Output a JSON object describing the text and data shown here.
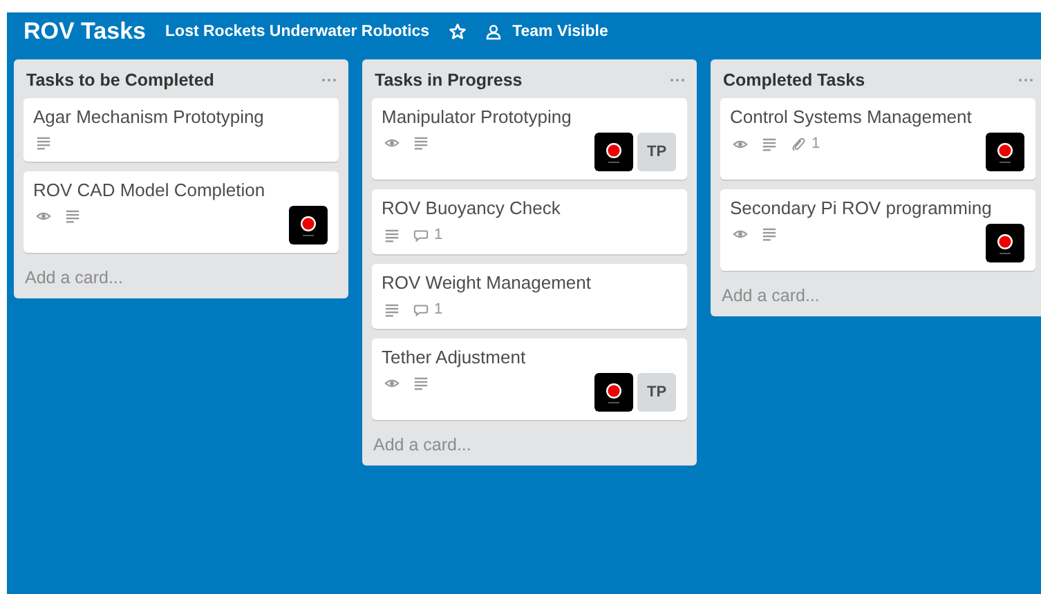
{
  "board": {
    "title": "ROV Tasks",
    "team": "Lost Rockets Underwater Robotics",
    "starred": false,
    "visibility": "Team Visible"
  },
  "lists": [
    {
      "title": "Tasks to be Completed",
      "add_card": "Add a card...",
      "cards": [
        {
          "title": "Agar Mechanism Prototyping",
          "badges": [
            {
              "kind": "description"
            }
          ]
        },
        {
          "title": "ROV CAD Model Completion",
          "badges": [
            {
              "kind": "watch"
            },
            {
              "kind": "description"
            }
          ],
          "members": [
            {
              "kind": "avatar"
            }
          ]
        }
      ]
    },
    {
      "title": "Tasks in Progress",
      "add_card": "Add a card...",
      "cards": [
        {
          "title": "Manipulator Prototyping",
          "badges": [
            {
              "kind": "watch"
            },
            {
              "kind": "description"
            }
          ],
          "members": [
            {
              "kind": "avatar"
            },
            {
              "kind": "initials",
              "initials": "TP"
            }
          ]
        },
        {
          "title": "ROV Buoyancy Check",
          "badges": [
            {
              "kind": "description"
            },
            {
              "kind": "comments",
              "count": "1"
            }
          ]
        },
        {
          "title": "ROV Weight Management",
          "badges": [
            {
              "kind": "description"
            },
            {
              "kind": "comments",
              "count": "1"
            }
          ]
        },
        {
          "title": "Tether Adjustment",
          "badges": [
            {
              "kind": "watch"
            },
            {
              "kind": "description"
            }
          ],
          "members": [
            {
              "kind": "avatar"
            },
            {
              "kind": "initials",
              "initials": "TP"
            }
          ]
        }
      ]
    },
    {
      "title": "Completed Tasks",
      "add_card": "Add a card...",
      "cards": [
        {
          "title": "Control Systems Management",
          "badges": [
            {
              "kind": "watch"
            },
            {
              "kind": "description"
            },
            {
              "kind": "attachments",
              "count": "1"
            }
          ],
          "members": [
            {
              "kind": "avatar"
            }
          ]
        },
        {
          "title": "Secondary Pi ROV programming",
          "badges": [
            {
              "kind": "watch"
            },
            {
              "kind": "description"
            }
          ],
          "members": [
            {
              "kind": "avatar"
            }
          ]
        }
      ]
    }
  ]
}
